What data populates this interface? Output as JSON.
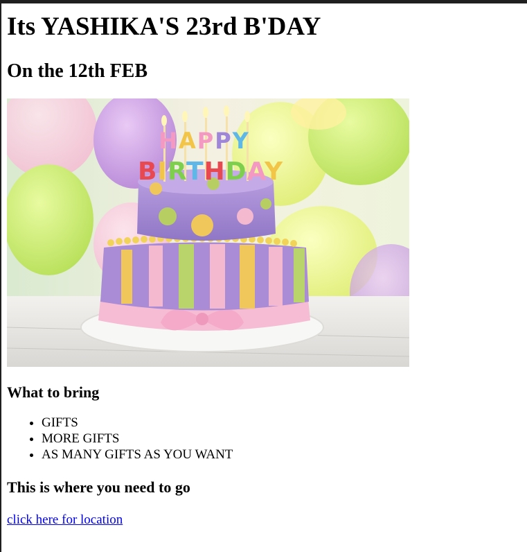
{
  "page": {
    "title": "Its YASHIKA'S 23rd B'DAY",
    "date": "On the 12th FEB"
  },
  "hero_image": {
    "alt": "birthday cake",
    "cake_text_top": "HAPPY",
    "cake_text_bottom": "BIRTHDAY"
  },
  "bring_section": {
    "heading": "What to bring",
    "items": [
      "GIFTS",
      "MORE GIFTS",
      "AS MANY GIFTS AS YOU WANT"
    ]
  },
  "location_section": {
    "heading": "This is where you need to go",
    "link_text": "click here for location"
  },
  "colors": {
    "link": "#0000ee",
    "top_bar": "#1f1f1f"
  }
}
